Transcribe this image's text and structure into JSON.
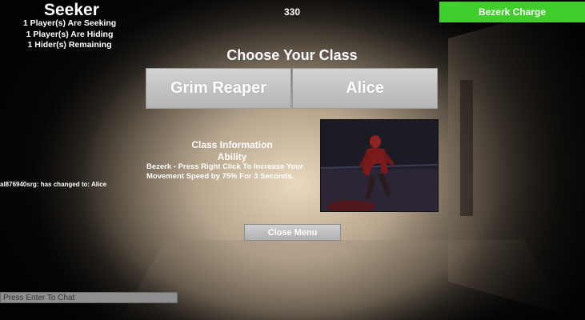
{
  "hud": {
    "role": "Seeker",
    "stats": [
      "1 Player(s) Are Seeking",
      "1 Player(s) Are Hiding",
      "1 Hider(s) Remaining"
    ],
    "timer": "330",
    "ability_button": "Bezerk Charge",
    "ability_button_color": "#3fce2b"
  },
  "feed": {
    "player": "al876940srg:",
    "message": "has changed to: Alice"
  },
  "chat": {
    "placeholder": "Press Enter To Chat"
  },
  "menu": {
    "title": "Choose Your Class",
    "classes": [
      "Grim Reaper",
      "Alice"
    ],
    "info_heading": "Class Information",
    "ability_heading": "Ability",
    "ability_description": "Bezerk - Press Right Click To Increase Your Movement Speed by 75% For 3 Seconds.",
    "portrait_icon": "character-portrait",
    "close_button": "Close Menu"
  }
}
